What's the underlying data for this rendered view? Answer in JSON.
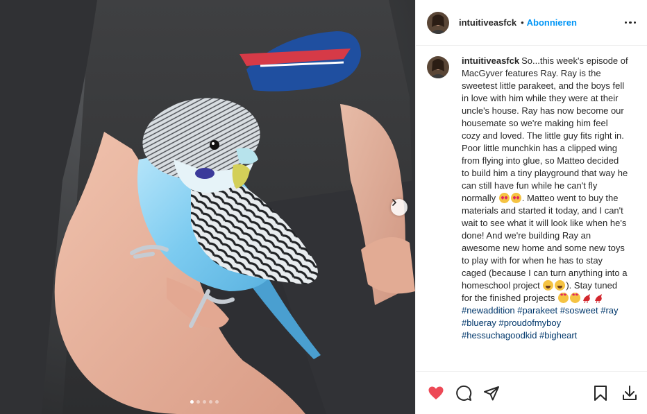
{
  "post": {
    "username": "intuitiveasfck",
    "follow_label": "Abonnieren",
    "separator": "•",
    "caption_user": "intuitiveasfck",
    "caption_parts": [
      "So...this week's episode of MacGyver features Ray. Ray is the sweetest little parakeet, and the boys fell in love with him while they were at their uncle's house. Ray has now become our housemate so we're making him feel cozy and loved. The little guy fits right in. Poor little munchkin has a clipped wing from flying into glue, so Matteo decided to build him a tiny playground that way he can still have fun while he can't fly normally ",
      ". Matteo went to buy the materials and started it today, and I can't wait to see what it will look like when he's done! And we're building Ray an awesome new home and some new toys to play with for when he has to stay caged (because I can turn anything into a homeschool project ",
      "). Stay tuned for the finished projects "
    ],
    "hashtags": [
      "#newaddition",
      "#parakeet",
      "#sosweet",
      "#ray",
      "#blueray",
      "#proudofmyboy",
      "#hessuchagoodkid",
      "#bigheart"
    ],
    "carousel": {
      "count": 5,
      "active": 0
    },
    "liked": true,
    "colors": {
      "accent": "#0095f6",
      "like": "#ed4956",
      "hashtag": "#00376b"
    }
  },
  "icons": {
    "more": "more-options-icon",
    "next": "chevron-right-icon",
    "like": "heart-icon",
    "comment": "comment-icon",
    "share": "send-icon",
    "save": "bookmark-icon",
    "download": "download-icon"
  }
}
